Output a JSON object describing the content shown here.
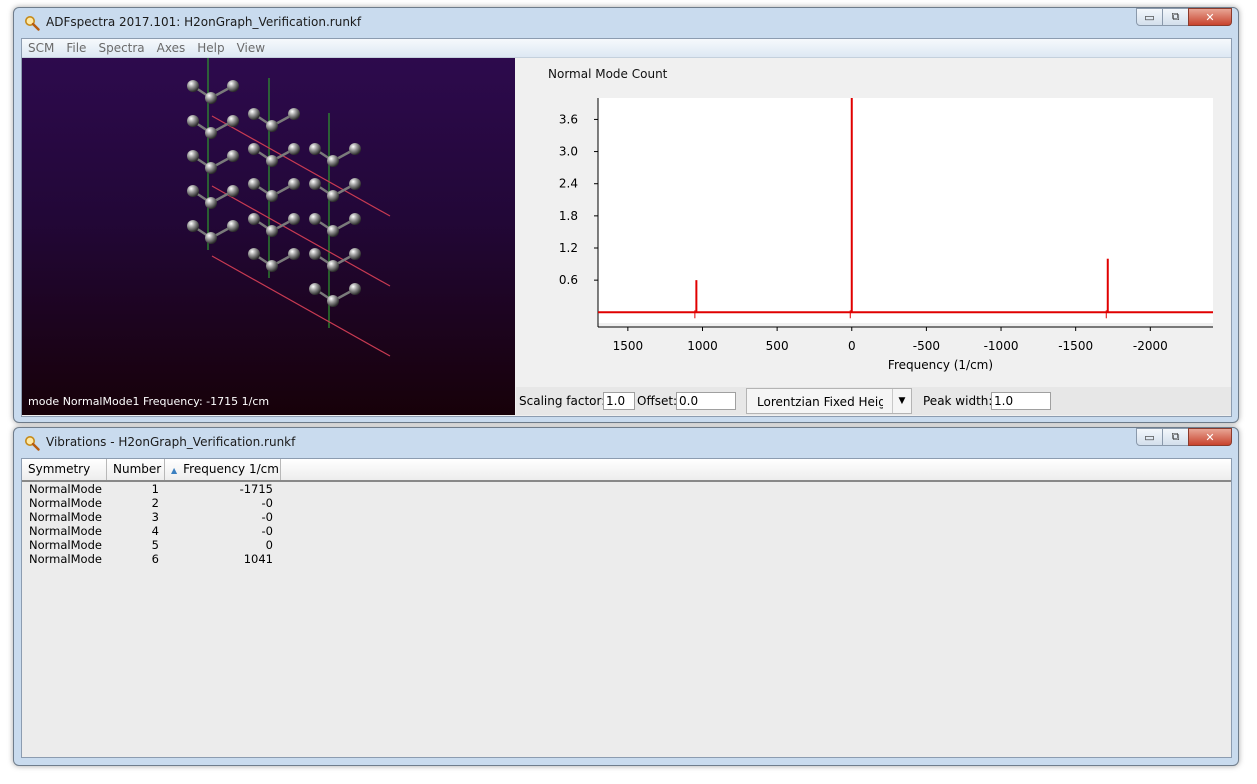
{
  "main_window": {
    "title": "ADFspectra 2017.101: H2onGraph_Verification.runkf",
    "menu": [
      "SCM",
      "File",
      "Spectra",
      "Axes",
      "Help",
      "View"
    ],
    "controls": {
      "minimize": "▭",
      "restore": "⧉",
      "close": "✕"
    }
  },
  "molecule_view": {
    "status": "mode NormalMode1 Frequency: -1715 1/cm"
  },
  "spectrum": {
    "title": "Normal Mode Count",
    "controls": {
      "scaling_label": "Scaling factor:",
      "scaling_value": "1.0",
      "offset_label": "Offset:",
      "offset_value": "0.0",
      "lineshape_value": "Lorentzian Fixed Heigh",
      "peak_width_label": "Peak width:",
      "peak_width_value": "1.0"
    }
  },
  "chart_data": {
    "type": "line",
    "title": "Normal Mode Count",
    "xlabel": "Frequency (1/cm)",
    "ylabel": "",
    "x_reversed": true,
    "xlim": [
      1700,
      -2420
    ],
    "ylim": [
      -0.2,
      4.0
    ],
    "xticks": [
      1500,
      1000,
      500,
      0,
      -500,
      -1000,
      -1500,
      -2000
    ],
    "xtick_labels": [
      "1500",
      "1000",
      "500",
      "0",
      "-500",
      "-1000",
      "-1500",
      "-2000"
    ],
    "yticks": [
      0.6,
      1.2,
      1.8,
      2.4,
      3.0,
      3.6
    ],
    "ytick_labels": [
      "0.6",
      "1.2",
      "1.8",
      "2.4",
      "3.0",
      "3.6"
    ],
    "baseline": 0,
    "peaks": [
      {
        "x": 1041,
        "y": 0.6
      },
      {
        "x": 0,
        "y": 4.0
      },
      {
        "x": -1715,
        "y": 1.0
      }
    ],
    "color": "#e00000"
  },
  "vibrations_window": {
    "title": "Vibrations - H2onGraph_Verification.runkf",
    "controls": {
      "minimize": "▭",
      "restore": "⧉",
      "close": "✕"
    },
    "columns": [
      "Symmetry",
      "Number",
      "Frequency 1/cm"
    ],
    "sort_indicator": "▲",
    "rows": [
      {
        "symmetry": "NormalMode",
        "number": "1",
        "frequency": "-1715"
      },
      {
        "symmetry": "NormalMode",
        "number": "2",
        "frequency": "-0"
      },
      {
        "symmetry": "NormalMode",
        "number": "3",
        "frequency": "-0"
      },
      {
        "symmetry": "NormalMode",
        "number": "4",
        "frequency": "-0"
      },
      {
        "symmetry": "NormalMode",
        "number": "5",
        "frequency": "0"
      },
      {
        "symmetry": "NormalMode",
        "number": "6",
        "frequency": "1041"
      }
    ]
  },
  "colors": {
    "spectrum_line": "#e00000",
    "viewer_background_top": "#2d0a4d",
    "viewer_background_bottom": "#170109",
    "axis_green": "#2e9a2e",
    "axis_red": "#c83a52"
  }
}
